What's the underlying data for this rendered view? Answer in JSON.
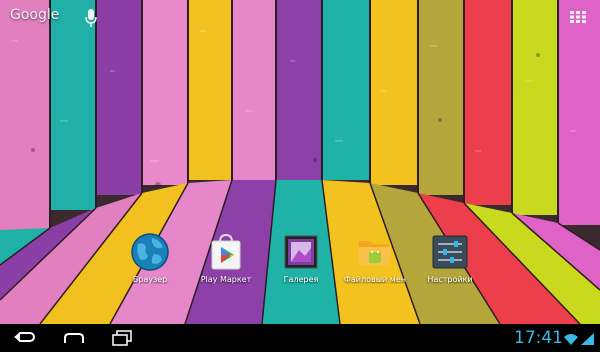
{
  "topbar": {
    "search_label": "Google"
  },
  "dock": {
    "items": [
      {
        "label": "Браузер"
      },
      {
        "label": "Play Маркет"
      },
      {
        "label": "Галерея"
      },
      {
        "label": "Файловый мен"
      },
      {
        "label": "Настройки"
      }
    ]
  },
  "status": {
    "time": "17:41"
  },
  "colors": {
    "clock": "#3ab8e8",
    "plank_pink": "#e67fc8",
    "plank_teal": "#22b3aa",
    "plank_purple": "#8d3fa8",
    "plank_yellow": "#f4c21e",
    "plank_olive": "#b6a63a",
    "plank_red": "#ee3f4a",
    "plank_lime": "#c8d91c",
    "plank_magenta": "#e064c7"
  },
  "icons": {
    "search": "google-logo",
    "voice": "microphone-icon",
    "apps": "app-drawer-icon",
    "back": "back-icon",
    "home": "home-icon",
    "recents": "recent-apps-icon",
    "wifi": "wifi-icon",
    "signal": "signal-icon"
  }
}
